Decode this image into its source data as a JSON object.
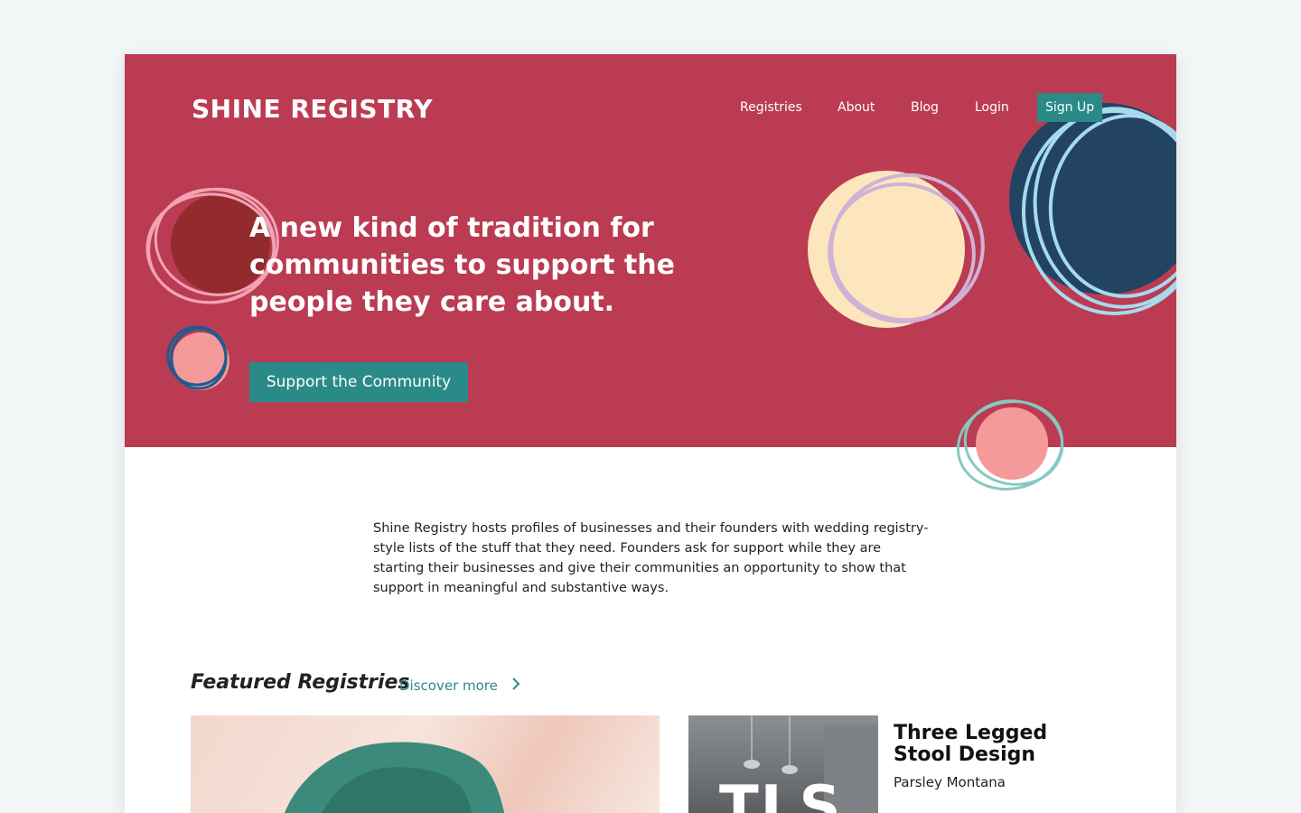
{
  "brand": {
    "name": "SHINE REGISTRY"
  },
  "nav": {
    "items": [
      "Registries",
      "About",
      "Blog",
      "Login"
    ],
    "signup_label": "Sign Up"
  },
  "hero": {
    "headline": "A new kind of tradition for communities to support the people they care about.",
    "cta_label": "Support the Community"
  },
  "intro": {
    "text": "Shine Registry hosts profiles of businesses and their founders with wedding registry-style lists of the stuff that they need. Founders ask for support while they are starting their businesses and give their communities an opportunity to show that support in meaningful and substantive ways."
  },
  "featured": {
    "title": "Featured Registries",
    "discover_label": "Discover more",
    "discover_icon": "chevron-right-icon",
    "cards": [
      {
        "image": "green-suede-shoe-photo"
      },
      {
        "image": "kitchen-photo",
        "image_text": "TLS",
        "title": "Three Legged Stool Design",
        "owner": "Parsley Montana"
      }
    ]
  },
  "colors": {
    "hero_bg": "#bb3c52",
    "accent_teal": "#2a8a88",
    "page_bg": "#f2f6f7",
    "navy": "#224462",
    "cream": "#fde6bd",
    "pink": "#f59a9a",
    "maroon": "#922a2e"
  }
}
